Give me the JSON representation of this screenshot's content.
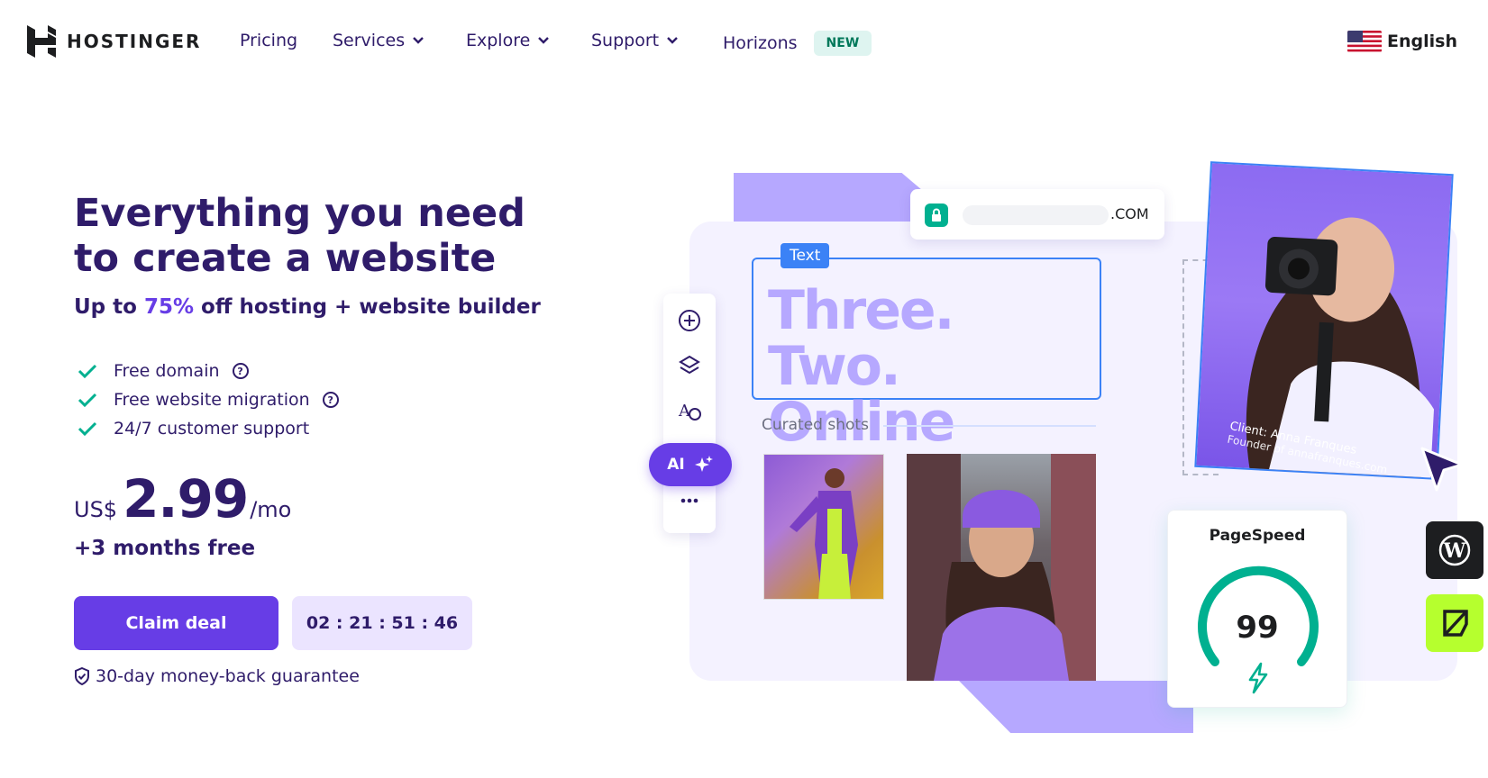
{
  "brand": {
    "name": "HOSTINGER"
  },
  "nav": {
    "items": [
      {
        "label": "Pricing",
        "dropdown": false
      },
      {
        "label": "Services",
        "dropdown": true
      },
      {
        "label": "Explore",
        "dropdown": true
      },
      {
        "label": "Support",
        "dropdown": true
      },
      {
        "label": "Horizons",
        "dropdown": false,
        "badge": "NEW"
      }
    ],
    "language": "English"
  },
  "hero": {
    "title": "Everything you need to create a website",
    "subtitle_prefix": "Up to ",
    "subtitle_accent": "75%",
    "subtitle_suffix": " off hosting + website builder",
    "features": [
      {
        "label": "Free domain",
        "help": true
      },
      {
        "label": "Free website migration",
        "help": true
      },
      {
        "label": "24/7 customer support",
        "help": false
      }
    ],
    "price": {
      "currency": "US$",
      "amount": "2.99",
      "period": "/mo"
    },
    "bonus": "+3 months free",
    "cta_label": "Claim deal",
    "countdown": "02 : 21 : 51 : 46",
    "guarantee": "30-day money-back guarantee"
  },
  "builder": {
    "url_tld": ".COM",
    "text_tag": "Text",
    "headline_line1": "Three. Two.",
    "headline_line2": "Online",
    "section_label": "Curated shots",
    "ai_label": "AI",
    "client_name": "Client: Anna Franques",
    "client_role": "Founder of annafranques.com",
    "pagespeed_label": "PageSpeed",
    "pagespeed_score": "99"
  },
  "colors": {
    "brand_purple": "#673de6",
    "dark_purple": "#2f1c6a",
    "light_purple": "#b6a8ff",
    "canvas_bg": "#f4f2ff",
    "success_green": "#00b090",
    "badge_bg": "#def4f0",
    "badge_text": "#00785a",
    "selection_blue": "#3b82f6"
  },
  "icons": [
    "hostinger-logo-icon",
    "chevron-down-icon",
    "us-flag-icon",
    "check-icon",
    "help-icon",
    "shield-icon",
    "lock-icon",
    "plus-circle-icon",
    "layers-icon",
    "palette-icon",
    "sparkles-icon",
    "more-icon",
    "cursor-arrow-icon",
    "lightning-icon",
    "wordpress-icon",
    "logo-frame-icon"
  ]
}
